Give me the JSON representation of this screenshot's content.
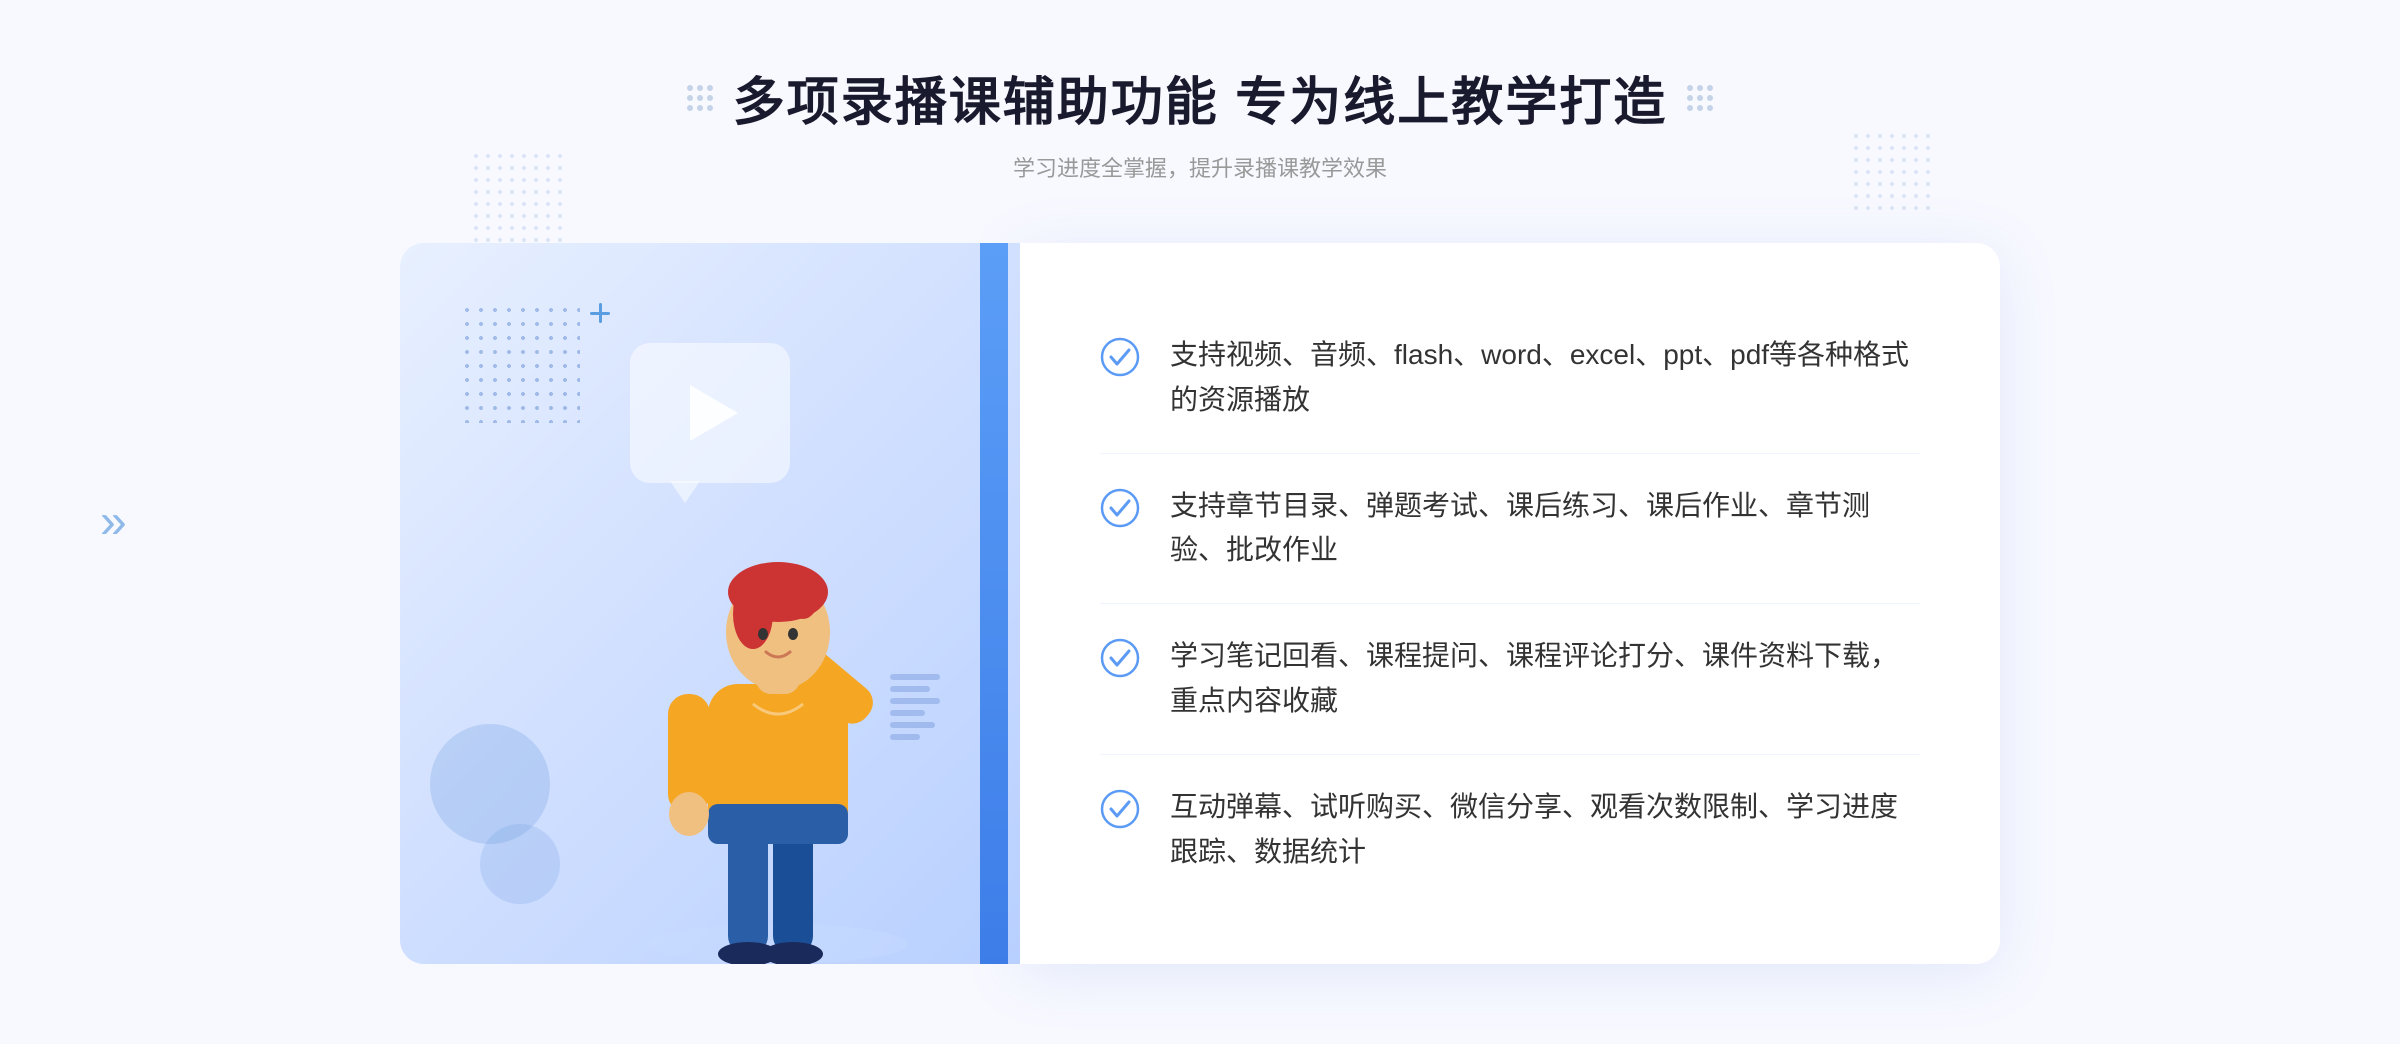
{
  "page": {
    "background": "#f8f9ff"
  },
  "header": {
    "title": "多项录播课辅助功能 专为线上教学打造",
    "subtitle": "学习进度全掌握，提升录播课教学效果"
  },
  "features": [
    {
      "id": 1,
      "text": "支持视频、音频、flash、word、excel、ppt、pdf等各种格式的资源播放"
    },
    {
      "id": 2,
      "text": "支持章节目录、弹题考试、课后练习、课后作业、章节测验、批改作业"
    },
    {
      "id": 3,
      "text": "学习笔记回看、课程提问、课程评论打分、课件资料下载，重点内容收藏"
    },
    {
      "id": 4,
      "text": "互动弹幕、试听购买、微信分享、观看次数限制、学习进度跟踪、数据统计"
    }
  ],
  "icons": {
    "check": "check-circle",
    "play": "▶",
    "chevron": "»"
  },
  "colors": {
    "primary": "#4a8ef5",
    "accent": "#3d7de8",
    "text_dark": "#1a1a2e",
    "text_medium": "#333333",
    "text_light": "#999999",
    "bg_light": "#f8f9ff",
    "check_color": "#5b9bf5"
  }
}
